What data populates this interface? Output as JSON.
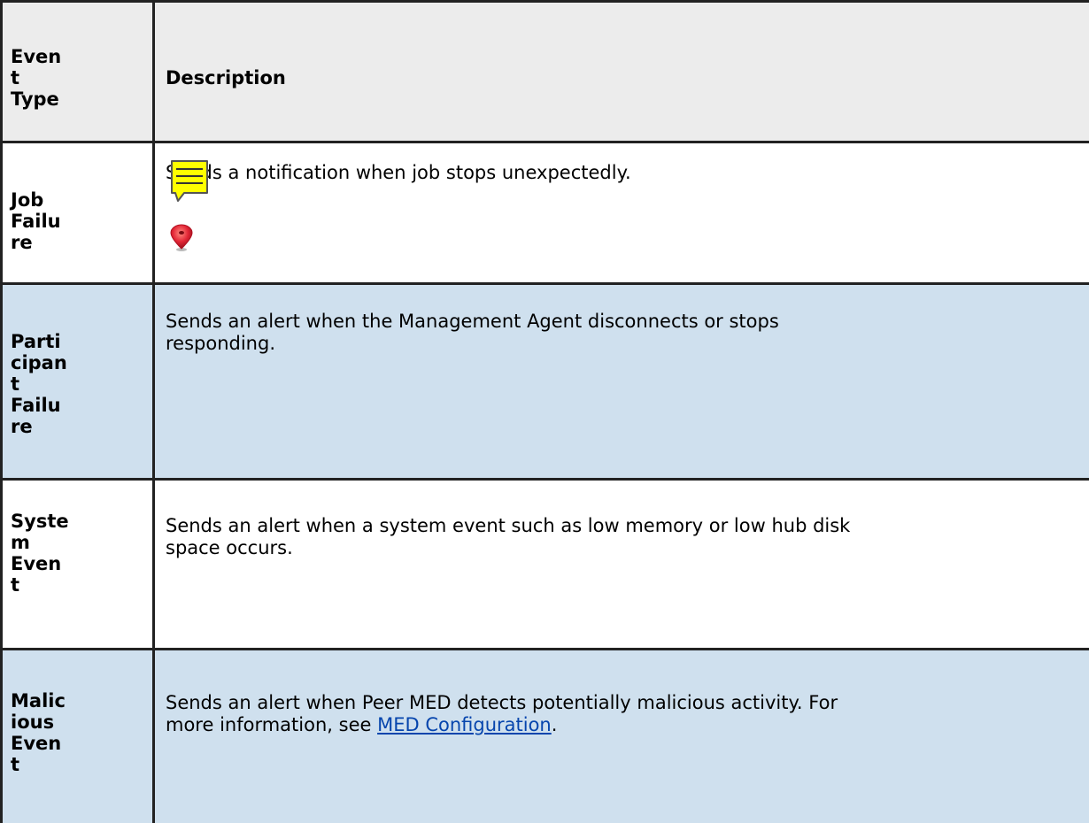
{
  "table": {
    "header": {
      "col1_lines": [
        "Even",
        "t",
        "Type"
      ],
      "col2": "Description"
    },
    "rows": [
      {
        "type_lines": [
          "Job",
          "Failu",
          "re"
        ],
        "description": "Sends a notification when job stops unexpectedly."
      },
      {
        "type_lines": [
          "Parti",
          "cipan",
          "t",
          "Failu",
          "re"
        ],
        "description_lines": [
          "Sends an alert when the Management Agent disconnects or stops",
          "responding."
        ]
      },
      {
        "type_lines": [
          "Syste",
          "m",
          "Even",
          "t"
        ],
        "description_lines": [
          "Sends an alert when a system event such as low memory or low hub disk",
          "space occurs."
        ]
      },
      {
        "type_lines": [
          "Malic",
          "ious",
          "Even",
          "t"
        ],
        "description_line1": "Sends an alert when Peer MED detects potentially malicious activity.  For",
        "description_line2_prefix": "more information, see ",
        "description_link": "MED Configuration",
        "description_line2_suffix": "."
      }
    ]
  },
  "icons": {
    "note": "note-icon",
    "pin": "map-pin-icon"
  },
  "colors": {
    "header_bg": "#ececec",
    "row_white": "#ffffff",
    "row_blue": "#cfe0ee",
    "border": "#222222",
    "link": "#0645ad",
    "note_yellow": "#ffff00",
    "pin_red": "#e32636"
  }
}
